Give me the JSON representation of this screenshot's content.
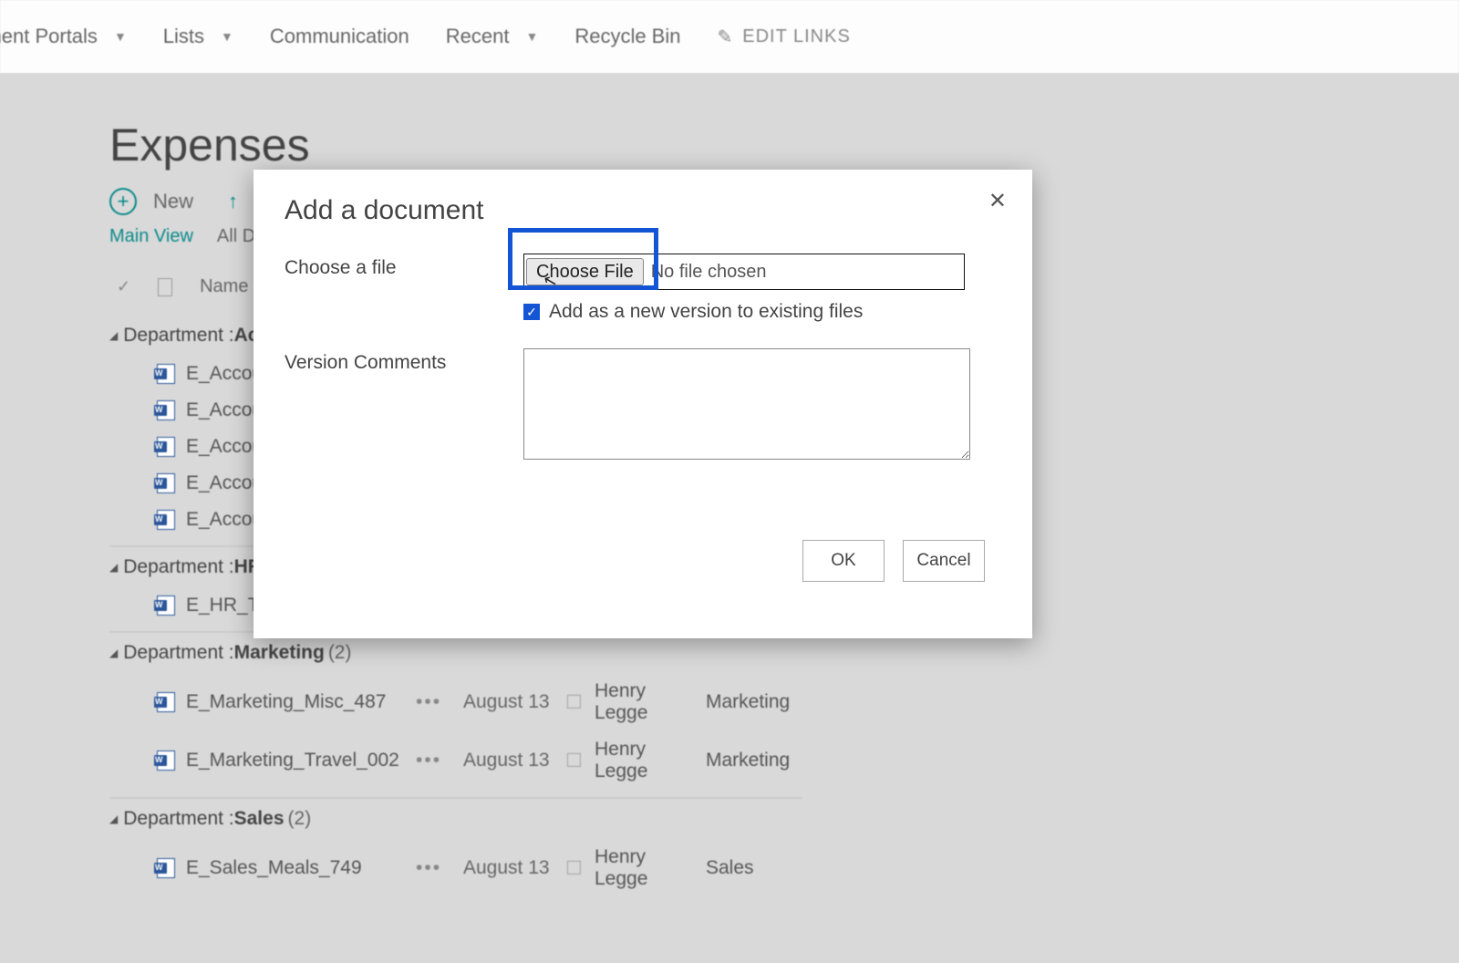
{
  "nav": {
    "items": [
      {
        "label": "rtment Portals",
        "has_caret": true
      },
      {
        "label": "Lists",
        "has_caret": true
      },
      {
        "label": "Communication",
        "has_caret": false
      },
      {
        "label": "Recent",
        "has_caret": true
      },
      {
        "label": "Recycle Bin",
        "has_caret": false
      }
    ],
    "edit_links": "EDIT LINKS"
  },
  "page": {
    "title": "Expenses",
    "toolbar": {
      "new_label": "New",
      "upload_label": "U"
    },
    "views": {
      "main": "Main View",
      "all": "All Dc"
    },
    "columns": {
      "name": "Name"
    }
  },
  "groups": [
    {
      "label_prefix": "Department : ",
      "label_strong": "Acc",
      "count": "",
      "items": [
        {
          "name": "E_Accou"
        },
        {
          "name": "E_Accou"
        },
        {
          "name": "E_Accou"
        },
        {
          "name": "E_Accou"
        },
        {
          "name": "E_Accou"
        }
      ]
    },
    {
      "label_prefix": "Department : ",
      "label_strong": "HR",
      "count": "",
      "items": [
        {
          "name": "E_HR_Tra"
        }
      ]
    },
    {
      "label_prefix": "Department : ",
      "label_strong": "Marketing",
      "count": "(2)",
      "items": [
        {
          "name": "E_Marketing_Misc_487",
          "date": "August 13",
          "person": "Henry Legge",
          "dept": "Marketing"
        },
        {
          "name": "E_Marketing_Travel_002",
          "date": "August 13",
          "person": "Henry Legge",
          "dept": "Marketing"
        }
      ]
    },
    {
      "label_prefix": "Department : ",
      "label_strong": "Sales",
      "count": "(2)",
      "items": [
        {
          "name": "E_Sales_Meals_749",
          "date": "August 13",
          "person": "Henry Legge",
          "dept": "Sales"
        }
      ]
    }
  ],
  "modal": {
    "title": "Add a document",
    "choose_label": "Choose a file",
    "choose_button": "Choose File",
    "no_file": "No file chosen",
    "version_check": "Add as a new version to existing files",
    "comments_label": "Version Comments",
    "ok": "OK",
    "cancel": "Cancel"
  }
}
